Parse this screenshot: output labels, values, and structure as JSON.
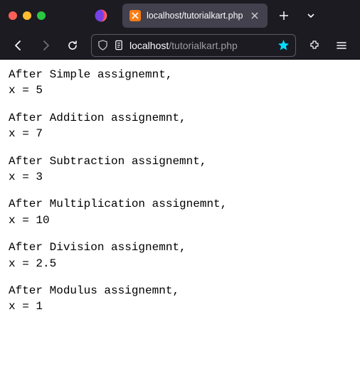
{
  "tab": {
    "title": "localhost/tutorialkart.php"
  },
  "url": {
    "host": "localhost",
    "path": "/tutorialkart.php"
  },
  "colors": {
    "bookmark_star": "#00ddff"
  },
  "output": [
    {
      "label": "After Simple assignemnt,",
      "value": "x = 5"
    },
    {
      "label": "After Addition assignemnt,",
      "value": "x = 7"
    },
    {
      "label": "After Subtraction assignemnt,",
      "value": "x = 3"
    },
    {
      "label": "After Multiplication assignemnt,",
      "value": "x = 10"
    },
    {
      "label": "After Division assignemnt,",
      "value": "x = 2.5"
    },
    {
      "label": "After Modulus assignemnt,",
      "value": "x = 1"
    }
  ]
}
